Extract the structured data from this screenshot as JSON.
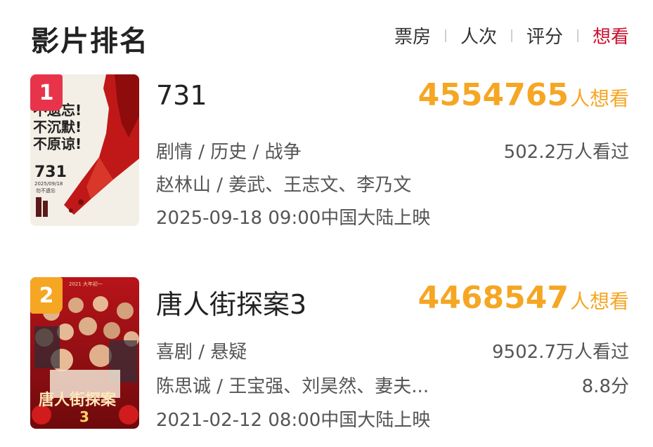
{
  "header": {
    "title": "影片排名",
    "tabs": [
      {
        "label": "票房",
        "active": false
      },
      {
        "label": "人次",
        "active": false
      },
      {
        "label": "评分",
        "active": false
      },
      {
        "label": "想看",
        "active": true
      }
    ]
  },
  "colors": {
    "accent": "#c8102e",
    "want": "#f5a623",
    "rank1": "#e8344a",
    "rank2": "#f5a623"
  },
  "movies": [
    {
      "rank": "1",
      "name": "731",
      "want_count": "4554765",
      "want_unit": "人想看",
      "genre": "剧情 / 历史 / 战争",
      "cast": "赵林山 / 姜武、王志文、李乃文",
      "release": "2025-09-18 09:00中国大陆上映",
      "watched": "502.2万人看过",
      "poster": {
        "slogan": [
          "不遗忘!",
          "不沉默!",
          "不原谅!"
        ],
        "title": "731",
        "date": "2025/09/18",
        "tag": "勿不遗忘"
      }
    },
    {
      "rank": "2",
      "name": "唐人街探案3",
      "want_count": "4468547",
      "want_unit": "人想看",
      "genre": "喜剧 / 悬疑",
      "cast": "陈思诚 / 王宝强、刘昊然、妻夫...",
      "release": "2021-02-12 08:00中国大陆上映",
      "watched": "9502.7万人看过",
      "score": "8.8分",
      "poster": {
        "top": "2021 大年初一",
        "title": "唐人街探案",
        "number": "3"
      }
    }
  ]
}
